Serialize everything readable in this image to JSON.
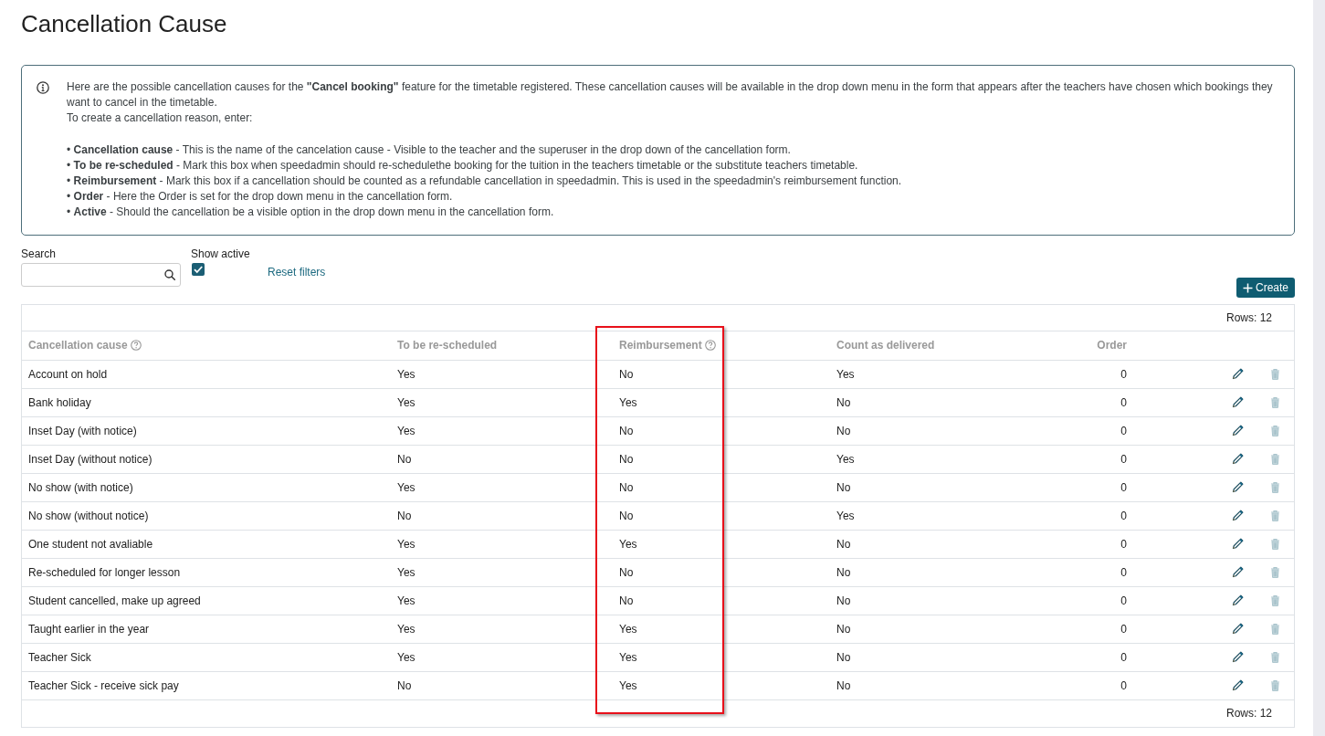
{
  "page": {
    "title": "Cancellation Cause"
  },
  "info": {
    "intro": "Here are the possible cancellation causes for the **\"Cancel booking\"** feature for the timetable registered. These cancellation causes will be available in the drop down menu in the form that appears after the teachers have chosen which bookings they want to cancel in the timetable.",
    "instruction": "To create a cancellation reason, enter:",
    "bullets": [
      "• **Cancellation cause** - This is the name of the cancelation cause - Visible to the teacher and the superuser in the drop down of the cancellation form.",
      "• **To be re-scheduled** - Mark this box when speedadmin should re-schedulethe booking for the tuition in the teachers timetable or the substitute teachers timetable.",
      "• **Reimbursement** - Mark this box if a cancellation should be counted as a refundable cancellation in speedadmin. This is used in the speedadmin's reimbursement function.",
      "• **Order** - Here the Order is set for the drop down menu in the cancellation form.",
      "• **Active** - Should the cancellation be a visible option in the drop down menu in the cancellation form."
    ]
  },
  "filters": {
    "search": {
      "label": "Search"
    },
    "show_active": {
      "label": "Show active",
      "checked": true
    },
    "reset_link": "Reset filters"
  },
  "create_button": "Create",
  "table": {
    "top_count": "Rows: 12",
    "columns": [
      {
        "label": "Cancellation cause",
        "kind": "text",
        "has_help": true,
        "highlighted": false
      },
      {
        "label": "To be re-scheduled",
        "kind": "boolean",
        "has_help": false,
        "highlighted": false
      },
      {
        "label": "Reimbursement",
        "kind": "boolean",
        "has_help": true,
        "highlighted": true
      },
      {
        "label": "Count as delivered",
        "kind": "boolean",
        "has_help": false,
        "highlighted": false
      },
      {
        "label": "Order",
        "kind": "number",
        "has_help": false,
        "highlighted": false
      }
    ],
    "rows": [
      {
        "cells": [
          "Account on hold",
          "Yes",
          "No",
          "Yes",
          "0"
        ]
      },
      {
        "cells": [
          "Bank holiday",
          "Yes",
          "Yes",
          "No",
          "0"
        ]
      },
      {
        "cells": [
          "Inset Day (with notice)",
          "Yes",
          "No",
          "No",
          "0"
        ]
      },
      {
        "cells": [
          "Inset Day (without notice)",
          "No",
          "No",
          "Yes",
          "0"
        ]
      },
      {
        "cells": [
          "No show (with notice)",
          "Yes",
          "No",
          "No",
          "0"
        ]
      },
      {
        "cells": [
          "No show (without notice)",
          "No",
          "No",
          "Yes",
          "0"
        ]
      },
      {
        "cells": [
          "One student not avaliable",
          "Yes",
          "Yes",
          "No",
          "0"
        ]
      },
      {
        "cells": [
          "Re-scheduled for longer lesson",
          "Yes",
          "No",
          "No",
          "0"
        ]
      },
      {
        "cells": [
          "Student cancelled, make up agreed",
          "Yes",
          "No",
          "No",
          "0"
        ]
      },
      {
        "cells": [
          "Taught earlier in the year",
          "Yes",
          "Yes",
          "No",
          "0"
        ]
      },
      {
        "cells": [
          "Teacher Sick",
          "Yes",
          "Yes",
          "No",
          "0"
        ]
      },
      {
        "cells": [
          "Teacher Sick - receive sick pay",
          "No",
          "Yes",
          "No",
          "0"
        ]
      }
    ],
    "bottom_count": "Rows: 12"
  }
}
